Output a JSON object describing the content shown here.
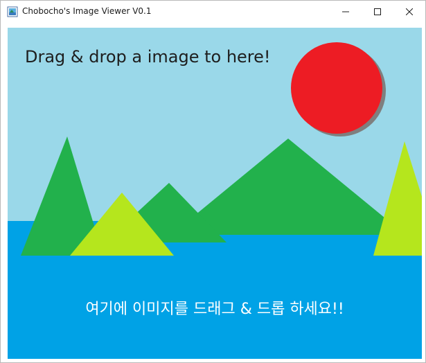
{
  "window": {
    "title": "Chobocho's Image Viewer V0.1"
  },
  "icons": {
    "app": "image-viewer-icon",
    "minimize": "minimize-icon",
    "maximize": "maximize-icon",
    "close": "close-icon"
  },
  "canvas": {
    "instruction_en": "Drag & drop a image to here!",
    "instruction_ko": "여기에 이미지를 드래그 & 드롭 하세요!!"
  },
  "colors": {
    "sky": "#9ad8e9",
    "water": "#00a2e6",
    "mountain": "#22b14c",
    "mountain_light": "#b5e61d",
    "sun": "#ed1c24",
    "sun_shadow": "#7f7f7f"
  }
}
